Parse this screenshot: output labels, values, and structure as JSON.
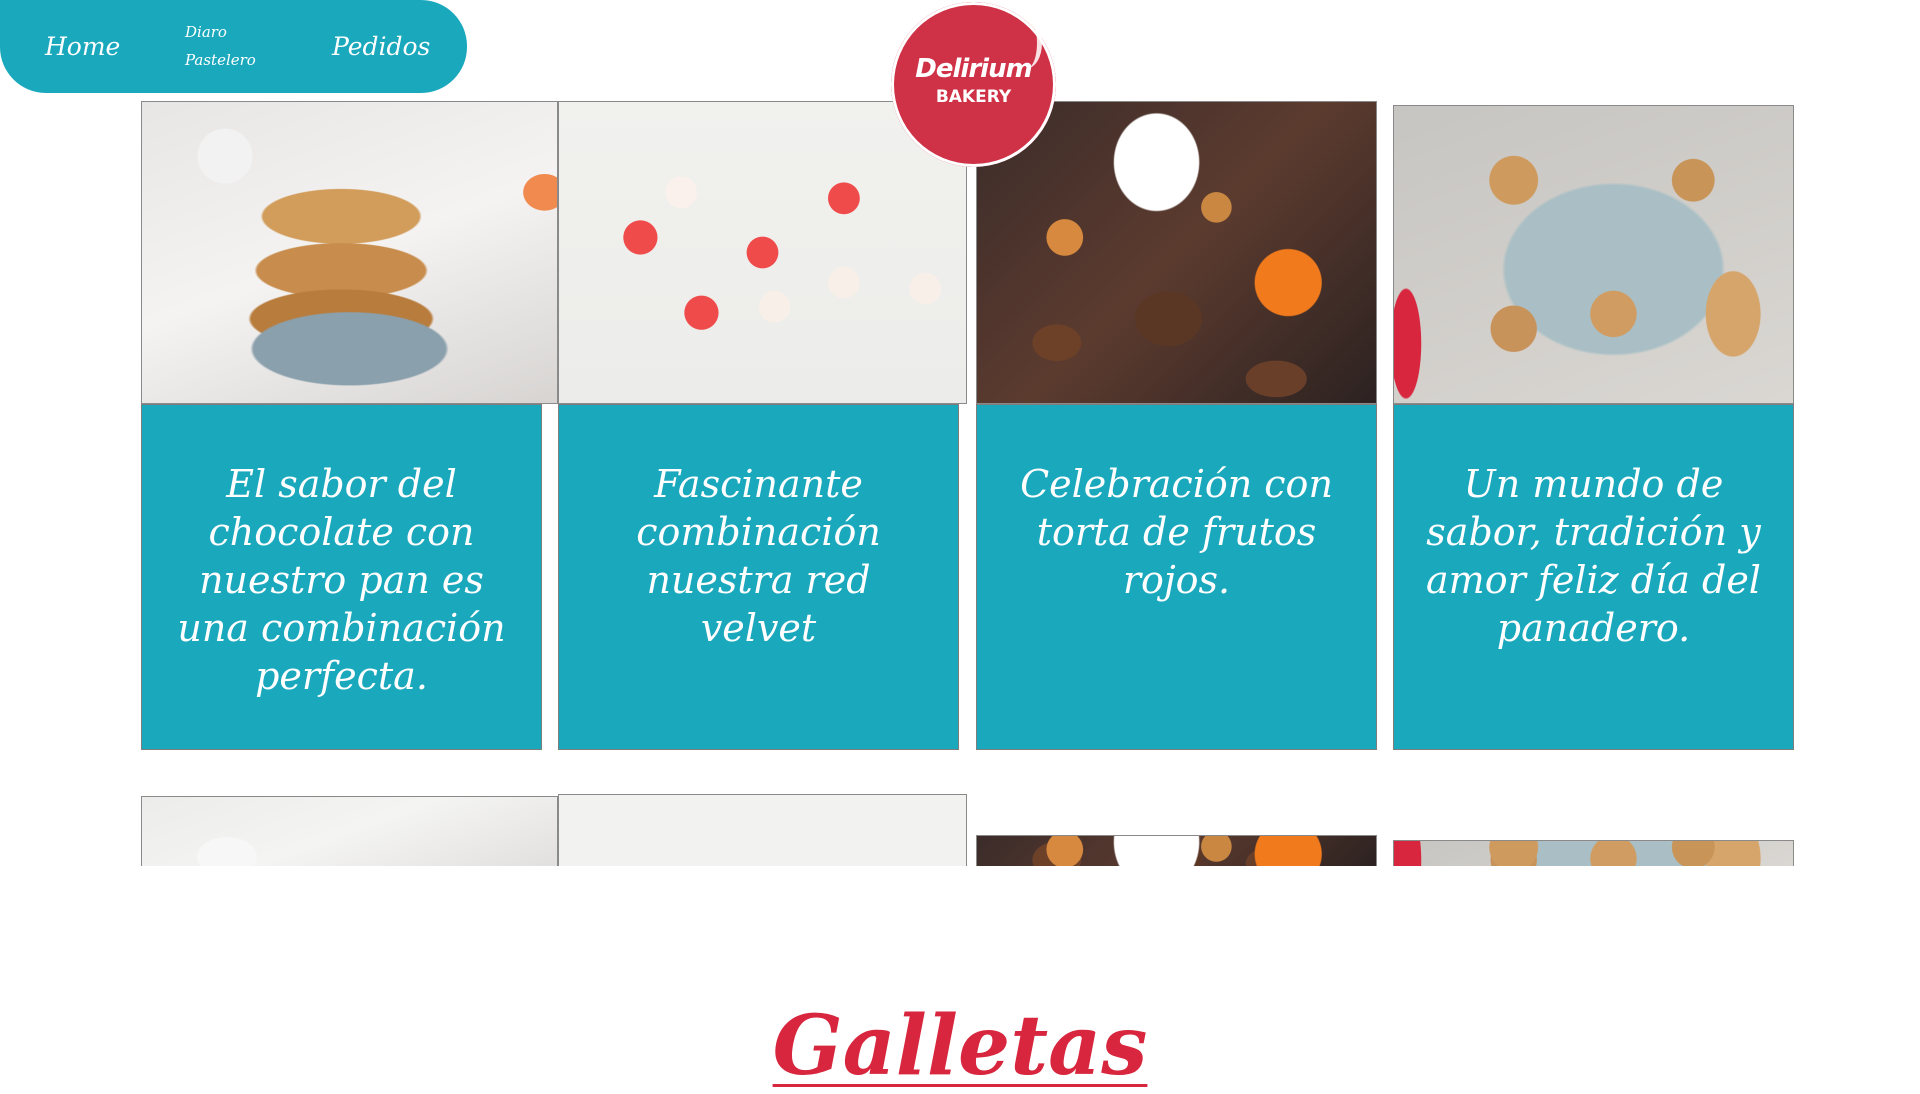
{
  "nav": {
    "items": [
      {
        "label": "Home"
      },
      {
        "label": "Diaro Pastelero"
      },
      {
        "label": "Pedidos"
      }
    ]
  },
  "logo": {
    "line1": "Delirium",
    "line2": "BAKERY"
  },
  "cards": [
    {
      "caption": "El sabor del chocolate con nuestro pan es una combinación perfecta.",
      "image": "cookies-stack-photo"
    },
    {
      "caption": "Fascinante combinación nuestra red velvet",
      "image": "heart-cookies-photo"
    },
    {
      "caption": "Celebración con torta de frutos rojos.",
      "image": "halloween-treats-photo"
    },
    {
      "caption": "Un mundo de sabor, tradición y amor feliz día del panadero.",
      "image": "gingerbread-cookies-photo"
    }
  ],
  "section": {
    "title": "Galletas"
  },
  "colors": {
    "teal": "#1aa8bd",
    "brand_red": "#d7263d",
    "logo_red": "#cf3246"
  }
}
